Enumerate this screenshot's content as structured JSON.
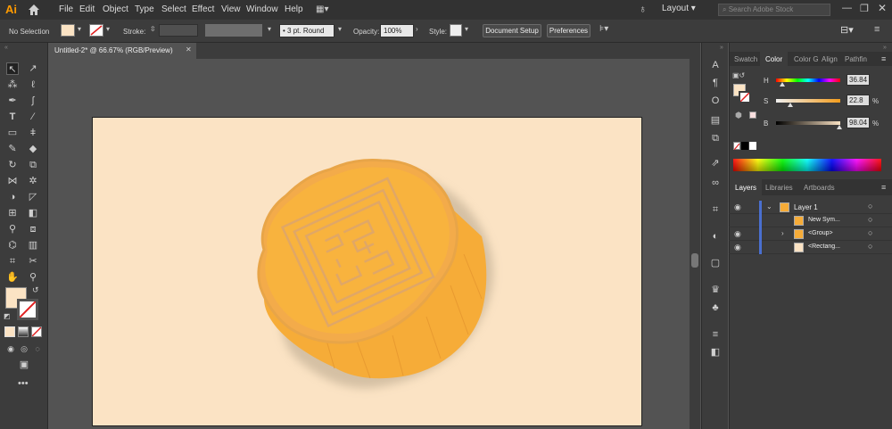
{
  "app": {
    "logo": "Ai"
  },
  "menu": [
    "File",
    "Edit",
    "Object",
    "Type",
    "Select",
    "Effect",
    "View",
    "Window",
    "Help"
  ],
  "workspace": {
    "layout_label": "Layout",
    "search_placeholder": "Search Adobe Stock"
  },
  "control": {
    "selection": "No Selection",
    "stroke_label": "Stroke:",
    "brush": "3 pt. Round",
    "opacity_label": "Opacity:",
    "opacity_value": "100%",
    "style_label": "Style:",
    "doc_setup": "Document Setup",
    "preferences": "Preferences",
    "fill_color": "#fbe3c4"
  },
  "document": {
    "tab_title": "Untitled-2* @ 66.67% (RGB/Preview)",
    "artboard_color": "#fbe3c4"
  },
  "color_panel": {
    "tabs": [
      "Swatch",
      "Color",
      "Color G",
      "Align",
      "Pathfin"
    ],
    "active_tab": "Color",
    "h_label": "H",
    "h_value": "36.84",
    "s_label": "S",
    "s_value": "22.8",
    "b_label": "B",
    "b_value": "98.04",
    "pct": "%",
    "h_level": 0.1,
    "s_level": 0.22,
    "b_level": 0.98
  },
  "layers_panel": {
    "tabs": [
      "Layers",
      "Libraries",
      "Artboards"
    ],
    "active_tab": "Layers",
    "rows": [
      {
        "name": "Layer 1"
      },
      {
        "name": "New Sym..."
      },
      {
        "name": "<Group>"
      },
      {
        "name": "<Rectang..."
      }
    ]
  },
  "mooncake": {
    "top_color": "#f8b33e",
    "side_color": "#f6ac38",
    "rim_color": "#f3ab4a",
    "pattern_color": "#e0a766",
    "shadow_color": "#b6a48a"
  }
}
